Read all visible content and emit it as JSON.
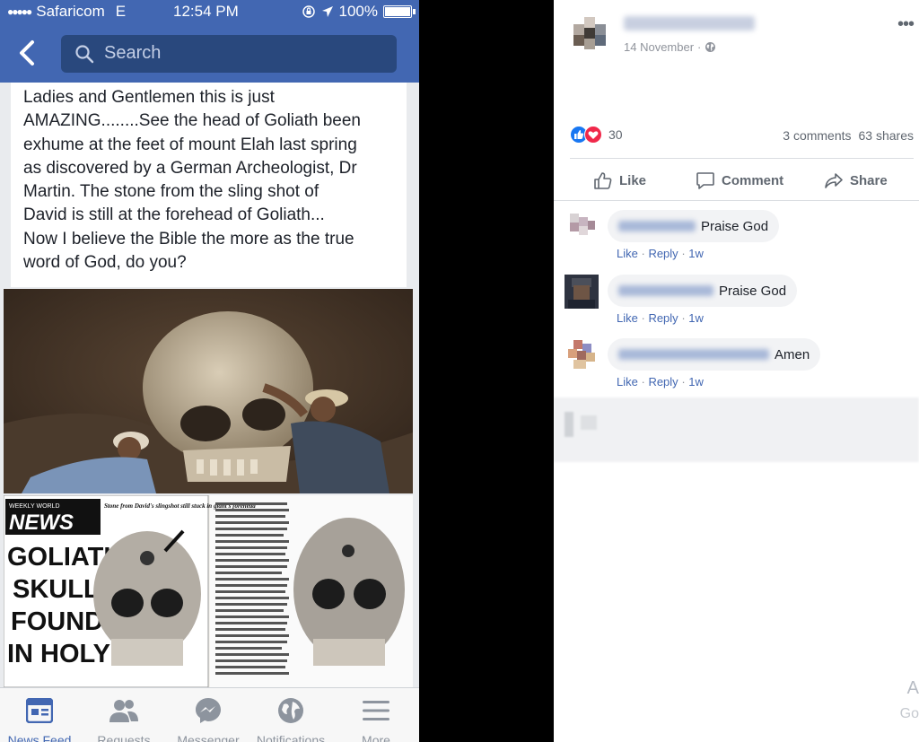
{
  "phone": {
    "status": {
      "carrier": "Safaricom",
      "network": "E",
      "time": "12:54 PM",
      "battery": "100%"
    },
    "search": {
      "placeholder": "Search"
    },
    "post_text": "Ladies and Gentlemen this is just\nAMAZING........See the head of Goliath been\nexhume at the feet of mount Elah last spring\nas discovered by a German Archeologist, Dr\nMartin. The stone from the sling shot of\nDavid is still at the forehead of Goliath...\nNow I believe the Bible the more as the true\nword of God, do you?",
    "newspaper": {
      "masthead": "NEWS",
      "masthead_small": "WEEKLY WORLD",
      "headline": "GOLIATH'S SKULL FOUND IN HOLY LAND!",
      "caption": "Stone from David's slingshot still stuck in giant's forehead"
    },
    "tabs": [
      {
        "label": "News Feed",
        "icon": "news-feed-icon",
        "active": true
      },
      {
        "label": "Requests",
        "icon": "friend-requests-icon",
        "active": false
      },
      {
        "label": "Messenger",
        "icon": "messenger-icon",
        "active": false
      },
      {
        "label": "Notifications",
        "icon": "globe-icon",
        "active": false
      },
      {
        "label": "More",
        "icon": "menu-icon",
        "active": false
      }
    ]
  },
  "fb": {
    "post_date": "14 November",
    "reaction_count": "30",
    "comments_count": "3 comments",
    "shares_count": "63 shares",
    "actions": {
      "like": "Like",
      "comment": "Comment",
      "share": "Share"
    },
    "comments": [
      {
        "text": "Praise God",
        "like": "Like",
        "reply": "Reply",
        "time": "1w"
      },
      {
        "text": "Praise God",
        "like": "Like",
        "reply": "Reply",
        "time": "1w"
      },
      {
        "text": "Amen",
        "like": "Like",
        "reply": "Reply",
        "time": "1w"
      }
    ],
    "sidebar_cut": {
      "a": "A",
      "b": "Go"
    }
  },
  "colors": {
    "brand": "#4267b2",
    "link": "#4267b2",
    "reaction_like": "#1877f2",
    "reaction_love": "#f0284a"
  }
}
